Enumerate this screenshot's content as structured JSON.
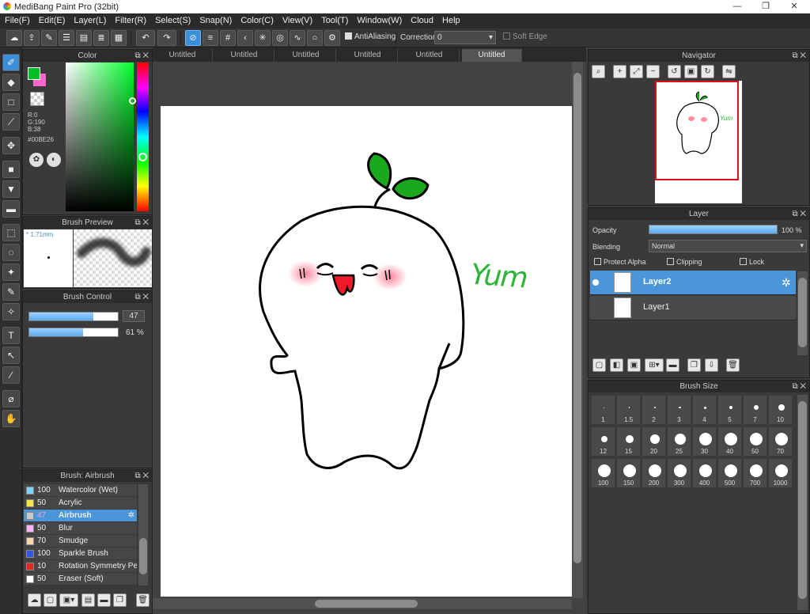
{
  "window": {
    "title": "MediBang Paint Pro (32bit)",
    "minimize": "—",
    "restore": "❐",
    "close": "✕"
  },
  "menu": [
    "File(F)",
    "Edit(E)",
    "Layer(L)",
    "Filter(R)",
    "Select(S)",
    "Snap(N)",
    "Color(C)",
    "View(V)",
    "Tool(T)",
    "Window(W)",
    "Cloud",
    "Help"
  ],
  "toolbar": {
    "antialiasing_label": "AntiAliasing",
    "correction_label": "Correction",
    "correction_value": "0",
    "soft_edge_label": "Soft Edge"
  },
  "color_panel": {
    "title": "Color",
    "r": "R:0",
    "g": "G:190",
    "b": "B:38",
    "hex": "#00BE26",
    "fg_color": "#00be26",
    "bg_color": "#ff66cc"
  },
  "brush_preview": {
    "title": "Brush Preview",
    "size": "* 1.71mm"
  },
  "brush_control": {
    "title": "Brush Control",
    "size_value": "47",
    "size_fraction": 0.72,
    "opacity_value": "61 %",
    "opacity_fraction": 0.61
  },
  "tabs": [
    "Untitled",
    "Untitled",
    "Untitled",
    "Untitled",
    "Untitled",
    "Untitled"
  ],
  "canvas": {
    "handwriting": "Yum"
  },
  "brush_list": {
    "title": "Brush: Airbrush",
    "items": [
      {
        "size": "100",
        "name": "Watercolor (Wet)",
        "color": "#7fd4ff"
      },
      {
        "size": "50",
        "name": "Acrylic",
        "color": "#f5e63a"
      },
      {
        "size": "47",
        "name": "Airbrush",
        "color": "#c8c8c8"
      },
      {
        "size": "50",
        "name": "Blur",
        "color": "#f7b6f7"
      },
      {
        "size": "70",
        "name": "Smudge",
        "color": "#f5d8b0"
      },
      {
        "size": "100",
        "name": "Sparkle Brush",
        "color": "#3355ee"
      },
      {
        "size": "10",
        "name": "Rotation Symmetry Pen",
        "color": "#ee2222"
      },
      {
        "size": "50",
        "name": "Eraser (Soft)",
        "color": "#ffffff"
      }
    ]
  },
  "navigator": {
    "title": "Navigator"
  },
  "layer_panel": {
    "title": "Layer",
    "opacity_label": "Opacity",
    "opacity_value": "100 %",
    "blending_label": "Blending",
    "blending_value": "Normal",
    "protect_alpha": "Protect Alpha",
    "clipping": "Clipping",
    "lock": "Lock",
    "layers": [
      {
        "name": "Layer2"
      },
      {
        "name": "Layer1"
      }
    ]
  },
  "brush_size": {
    "title": "Brush Size",
    "sizes": [
      "1",
      "1.5",
      "2",
      "3",
      "4",
      "5",
      "7",
      "10",
      "12",
      "15",
      "20",
      "25",
      "30",
      "40",
      "50",
      "70",
      "100",
      "150",
      "200",
      "300",
      "400",
      "500",
      "700",
      "1000"
    ]
  }
}
